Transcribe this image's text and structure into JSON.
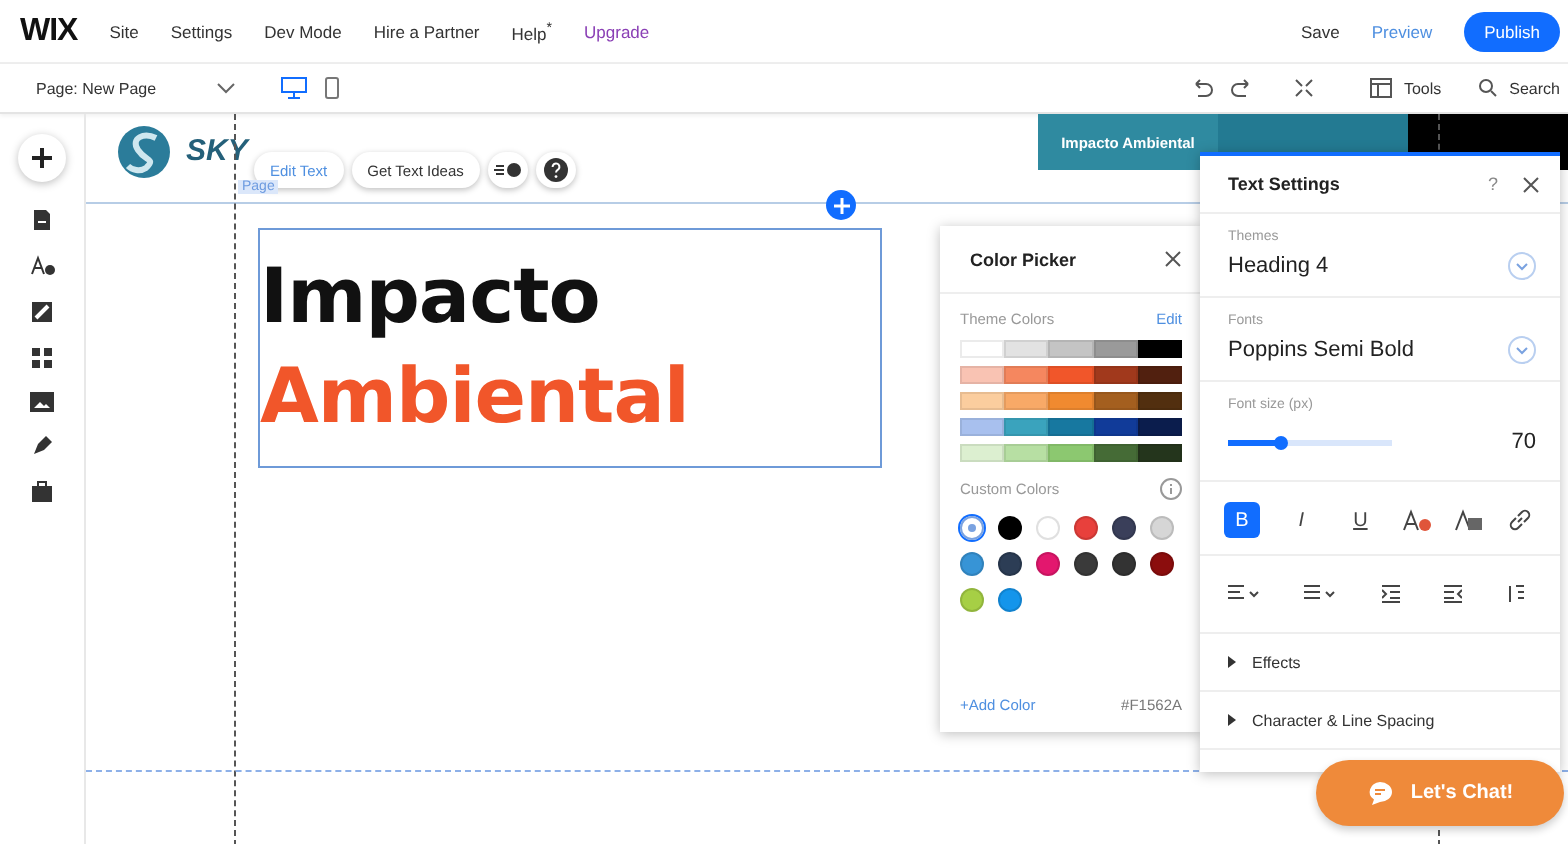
{
  "top_bar": {
    "logo": "WIX",
    "menu": [
      {
        "label": "Site",
        "highlight": false
      },
      {
        "label": "Settings",
        "highlight": false
      },
      {
        "label": "Dev Mode",
        "highlight": false
      },
      {
        "label": "Hire a Partner",
        "highlight": false
      },
      {
        "label": "Help$^{*}$",
        "highlight": false
      },
      {
        "label": "Upgrade",
        "highlight": true
      }
    ],
    "save": "Save",
    "preview": "Preview",
    "publish": "Publish"
  },
  "toolbar": {
    "page_selector": "Page: New Page",
    "devices": [
      {
        "kind": "desktop",
        "selected": true
      },
      {
        "kind": "mobile",
        "selected": false
      }
    ],
    "tools": "Tools",
    "search": "Search"
  },
  "canvas": {
    "logo_text": "SKY",
    "banner_text": "Impacto Ambiental",
    "page_tag": "Page",
    "floating_actions": [
      "Edit Text",
      "Get Text Ideas"
    ],
    "heading": [
      {
        "text": "Impacto",
        "color": "#111111"
      },
      {
        "text": "Ambiental",
        "color": "#f1562a"
      }
    ]
  },
  "color_picker": {
    "title": "Color Picker",
    "theme_label": "Theme Colors",
    "edit": "Edit",
    "theme_rows": [
      [
        {
          "color": "#ffffff"
        },
        {
          "color": "#e2e2e2"
        },
        {
          "color": "#c4c4c4"
        },
        {
          "color": "#9a9a9a"
        },
        {
          "color": "#000000"
        }
      ],
      [
        {
          "color": "#f9c3b3"
        },
        {
          "color": "#f5875f"
        },
        {
          "color": "#f1562a"
        },
        {
          "color": "#a1391c"
        },
        {
          "color": "#51200f"
        }
      ],
      [
        {
          "color": "#fbcd9e"
        },
        {
          "color": "#f8a967"
        },
        {
          "color": "#f08a30"
        },
        {
          "color": "#a45f1f"
        },
        {
          "color": "#522f0f"
        }
      ],
      [
        {
          "color": "#a8c0ee"
        },
        {
          "color": "#3aa3bd"
        },
        {
          "color": "#1778a0"
        },
        {
          "color": "#113b99"
        },
        {
          "color": "#0b1d4d"
        }
      ],
      [
        {
          "color": "#dcefd0"
        },
        {
          "color": "#b7dfa3"
        },
        {
          "color": "#8cc870"
        },
        {
          "color": "#456b36"
        },
        {
          "color": "#24351c"
        }
      ]
    ],
    "custom_label": "Custom Colors",
    "custom_colors": [
      {
        "kind": "add",
        "selected": true
      },
      {
        "color": "#000000",
        "selected": false
      },
      {
        "color": "#ffffff",
        "selected": false
      },
      {
        "color": "#e8403c",
        "selected": false
      },
      {
        "color": "#3a3f5a",
        "selected": false
      },
      {
        "color": "#d6d6d6",
        "selected": false
      },
      {
        "color": "#3794d6",
        "selected": false
      },
      {
        "color": "#2c3d55",
        "selected": false
      },
      {
        "color": "#e3176e",
        "selected": false
      },
      {
        "color": "#3a3a3a",
        "selected": false
      },
      {
        "color": "#333333",
        "selected": false
      },
      {
        "color": "#8b0d0d",
        "selected": false
      },
      {
        "color": "#a6cf45",
        "selected": false
      },
      {
        "color": "#1495eb",
        "selected": false
      }
    ],
    "add_color": "+Add Color",
    "hex": "#F1562A"
  },
  "text_settings": {
    "title": "Text Settings",
    "help": "?",
    "themes_label": "Themes",
    "theme_value": "Heading 4",
    "fonts_label": "Fonts",
    "font_value": "Poppins Semi Bold",
    "size_label": "Font size (px)",
    "size": {
      "level": 0.32
    },
    "size_value": "70",
    "format_buttons": [
      {
        "label": "B",
        "selected": true
      },
      {
        "label": "I",
        "selected": false
      },
      {
        "label": "U",
        "selected": false
      }
    ],
    "sections": [
      "Effects",
      "Character & Line Spacing"
    ]
  },
  "chat": "Let's Chat!"
}
